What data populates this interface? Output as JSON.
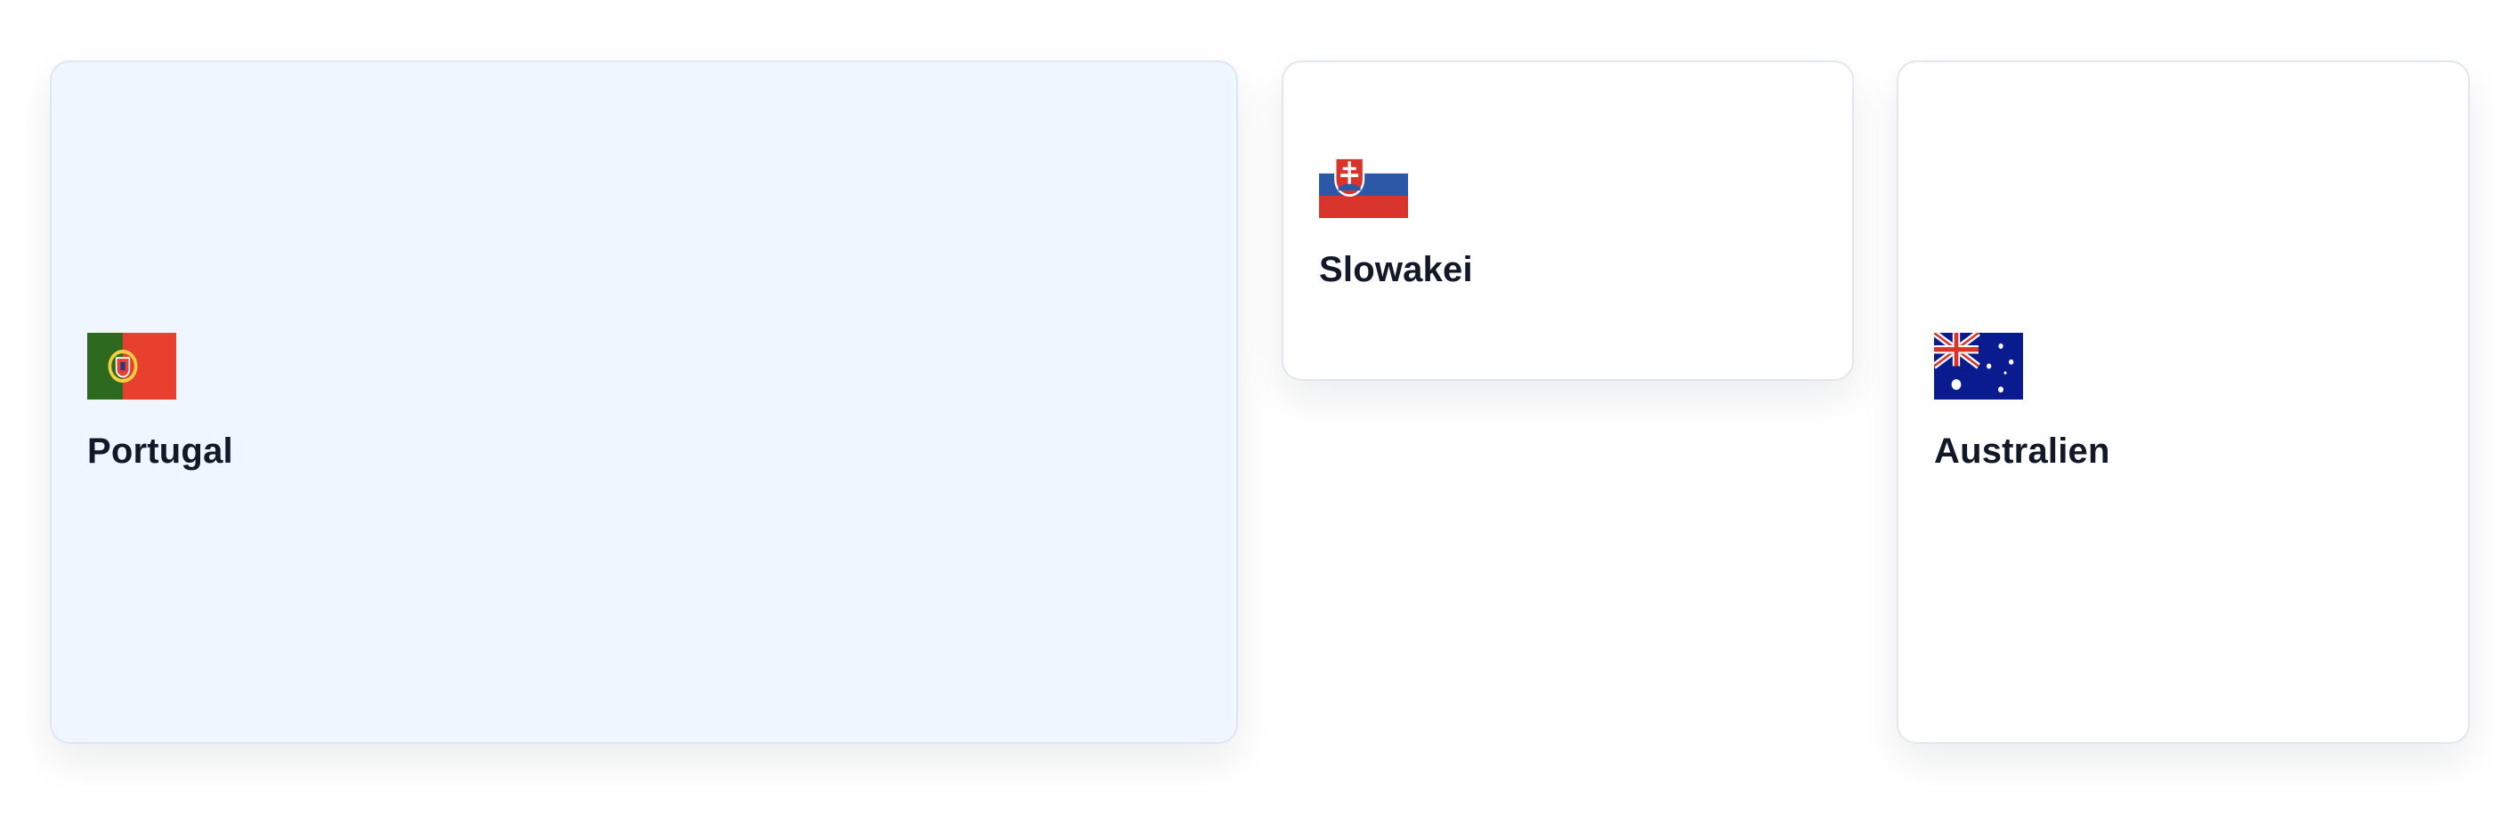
{
  "countries": [
    {
      "name": "Portugal",
      "flag_icon": "portugal-flag-icon",
      "selected": true
    },
    {
      "name": "Slowakei",
      "flag_icon": "slovakia-flag-icon",
      "selected": false
    },
    {
      "name": "Australien",
      "flag_icon": "australia-flag-icon",
      "selected": false
    }
  ],
  "colors": {
    "selected_card_bg": "#eff6ff",
    "card_bg": "#ffffff",
    "card_border": "#e3e6ea",
    "text": "#111827"
  }
}
